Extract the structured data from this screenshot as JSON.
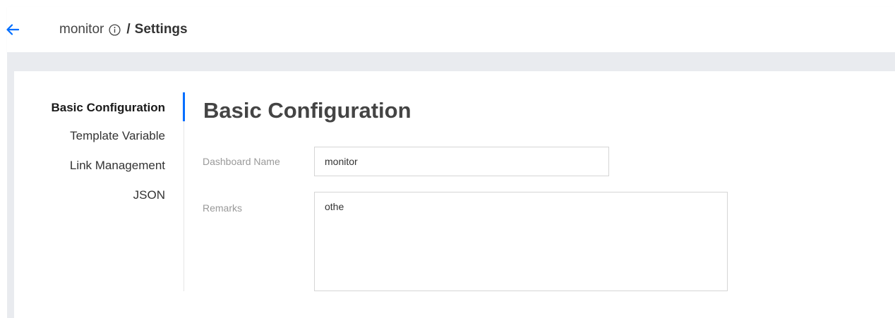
{
  "header": {
    "dashboard_name": "monitor",
    "separator": "/",
    "current_page": "Settings"
  },
  "icons": {
    "back": "back-arrow-icon",
    "info": "info-circle-icon"
  },
  "colors": {
    "accent": "#006eff",
    "background_band": "#e9ebef"
  },
  "sidebar": {
    "items": [
      {
        "label": "Basic Configuration",
        "active": true
      },
      {
        "label": "Template Variable",
        "active": false
      },
      {
        "label": "Link Management",
        "active": false
      },
      {
        "label": "JSON",
        "active": false
      }
    ]
  },
  "main": {
    "title": "Basic Configuration",
    "fields": {
      "dashboard_name": {
        "label": "Dashboard Name",
        "value": "monitor"
      },
      "remarks": {
        "label": "Remarks",
        "value": "othe"
      }
    }
  }
}
